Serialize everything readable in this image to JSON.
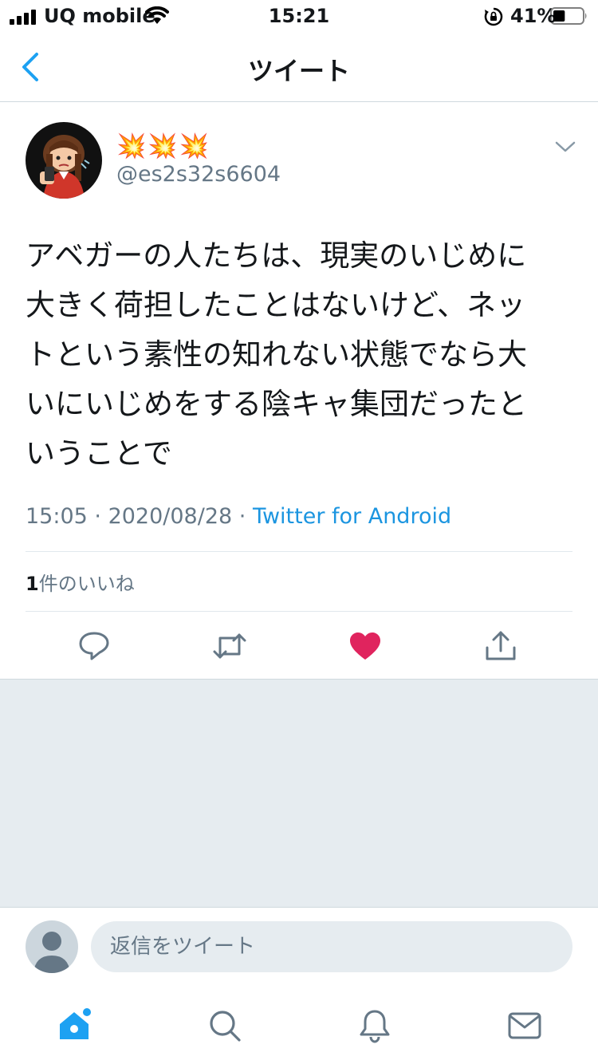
{
  "status_bar": {
    "carrier": "UQ mobile",
    "time": "15:21",
    "battery_percent": "41%",
    "battery_level": 0.41,
    "icons": [
      "signal-icon",
      "wifi-icon",
      "rotation-lock-icon",
      "battery-icon"
    ]
  },
  "nav": {
    "title": "ツイート",
    "back_icon": "chevron-left-icon"
  },
  "tweet": {
    "display_name": "💥💥💥",
    "handle": "@es2s32s6604",
    "text": "アベガーの人たちは、現実のいじめに\n大きく荷担したことはないけど、ネッ\nトという素性の知れない状態でなら大\nいにいじめをする陰キャ集団だったと\nいうことで",
    "time": "15:05",
    "separator": " · ",
    "date": "2020/08/28",
    "source": "Twitter for Android",
    "likes_count": "1",
    "likes_label": "件のいいね"
  },
  "actions": [
    "reply-icon",
    "retweet-icon",
    "like-icon",
    "share-icon"
  ],
  "reply_bar": {
    "placeholder": "返信をツイート"
  },
  "tab_bar": [
    "home-icon",
    "search-icon",
    "notifications-icon",
    "messages-icon"
  ],
  "colors": {
    "accent": "#1da1f2",
    "like": "#e0245e",
    "secondary_text": "#657786",
    "gray_background": "#e6ecf0"
  }
}
